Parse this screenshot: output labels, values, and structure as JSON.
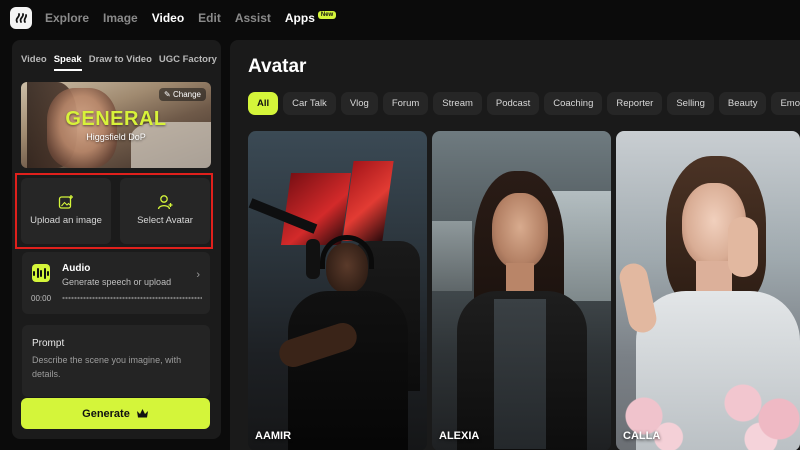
{
  "nav": {
    "logo_icon": "higgsfield-logo-icon",
    "items": [
      {
        "label": "Explore"
      },
      {
        "label": "Image"
      },
      {
        "label": "Video"
      },
      {
        "label": "Edit"
      },
      {
        "label": "Assist"
      },
      {
        "label": "Apps",
        "badge": "New"
      }
    ],
    "active": "Video"
  },
  "left_panel": {
    "tabs": [
      "Video",
      "Speak",
      "Draw to Video",
      "UGC Factory"
    ],
    "active_tab": "Speak",
    "banner": {
      "title": "GENERAL",
      "subtitle": "Higgsfield DoP",
      "change_label": "Change"
    },
    "upload_image_label": "Upload an image",
    "select_avatar_label": "Select Avatar",
    "audio": {
      "title": "Audio",
      "subtitle": "Generate speech or upload",
      "time": "00:00"
    },
    "prompt": {
      "title": "Prompt",
      "placeholder": "Describe the scene you imagine, with details."
    },
    "generate_label": "Generate",
    "colors": {
      "accent": "#d4f53a",
      "highlight": "#e0201c"
    }
  },
  "right_panel": {
    "title": "Avatar",
    "filters": [
      "All",
      "Car Talk",
      "Vlog",
      "Forum",
      "Stream",
      "Podcast",
      "Coaching",
      "Reporter",
      "Selling",
      "Beauty",
      "Emotions"
    ],
    "active_filter": "All",
    "avatars": [
      {
        "name": "AAMIR"
      },
      {
        "name": "ALEXIA"
      },
      {
        "name": "CALLA"
      }
    ]
  }
}
